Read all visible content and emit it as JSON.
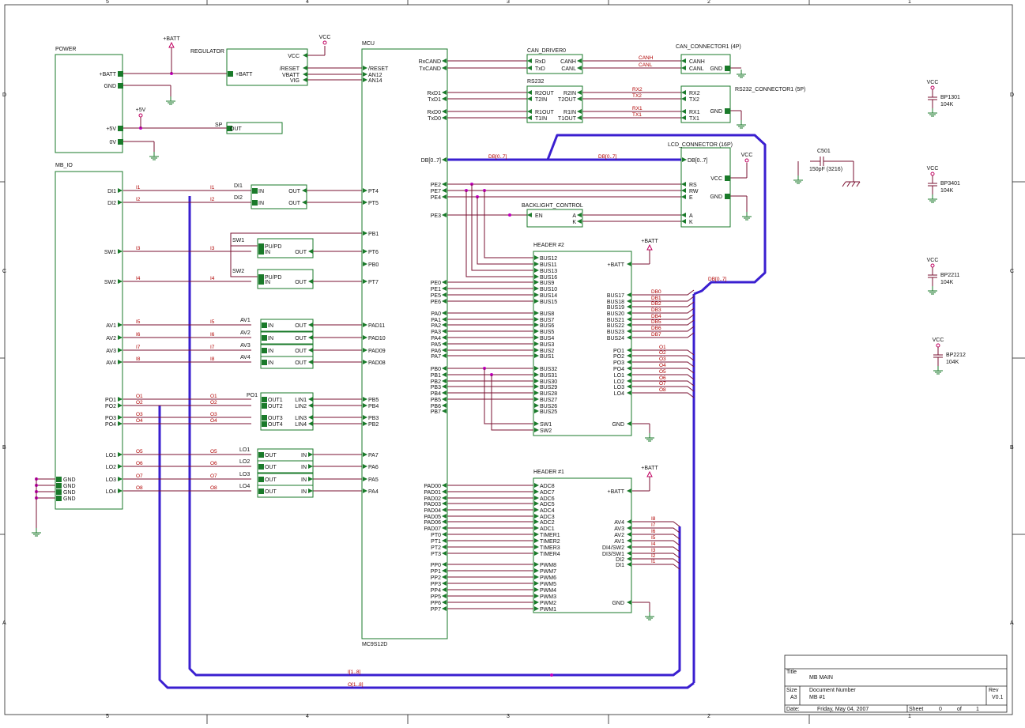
{
  "sheet": {
    "zone_labels_top": [
      "5",
      "4",
      "3",
      "2",
      "1"
    ],
    "zone_labels_side": [
      "D",
      "C",
      "B",
      "A"
    ]
  },
  "title_block": {
    "title_label": "Title",
    "title": "MB MAIN",
    "size_label": "Size",
    "size": "A3",
    "docnum_label": "Document Number",
    "docnum": "MB #1",
    "rev_label": "Rev",
    "rev": "V0.1",
    "date_label": "Date:",
    "date": "Friday, May 04, 2007",
    "sheet_label": "Sheet",
    "sheet_num": "0",
    "of_label": "of",
    "sheet_total": "1"
  },
  "power": {
    "name": "POWER",
    "pins": [
      "+BATT",
      "GND",
      "+5V",
      "0V"
    ]
  },
  "regulator": {
    "name": "REGULATOR",
    "in_pin": "+BATT",
    "out_pins": [
      "VCC",
      "/RESET",
      "VBATT",
      "VIG"
    ]
  },
  "sp": {
    "name": "SP",
    "pin": "OUT"
  },
  "supplies": {
    "batt": "+BATT",
    "vcc": "VCC",
    "p5v": "+5V"
  },
  "mbio": {
    "name": "MB_IO",
    "pins": [
      "DI1",
      "DI2",
      "SW1",
      "SW2",
      "AV1",
      "AV2",
      "AV3",
      "AV4",
      "PO1",
      "PO2",
      "PO3",
      "PO4",
      "LO1",
      "LO2",
      "LO3",
      "LO4"
    ],
    "gnd_pins": [
      "GND",
      "GND",
      "GND",
      "GND"
    ]
  },
  "nets_left": [
    "I1",
    "I2",
    "I3",
    "I4",
    "I5",
    "I6",
    "I7",
    "I8",
    "O1",
    "O2",
    "O3",
    "O4",
    "O5",
    "O6",
    "O7",
    "O8"
  ],
  "di_blocks": [
    {
      "name": "DI1",
      "in": "IN",
      "out": "OUT"
    },
    {
      "name": "DI2",
      "in": "IN",
      "out": "OUT"
    }
  ],
  "sw_blocks": [
    {
      "name": "SW1",
      "p1": "PU/PD",
      "p2": "IN",
      "out": "OUT"
    },
    {
      "name": "SW2",
      "p1": "PU/PD",
      "p2": "IN",
      "out": "OUT"
    }
  ],
  "av_blocks": [
    {
      "name": "AV1"
    },
    {
      "name": "AV2"
    },
    {
      "name": "AV3"
    },
    {
      "name": "AV4"
    }
  ],
  "po_block": {
    "name": "PO1",
    "pins_l": [
      "OUT1",
      "OUT2",
      "OUT3",
      "OUT4"
    ],
    "pins_r": [
      "LIN1",
      "LIN2",
      "LIN3",
      "LIN4"
    ]
  },
  "lo_blocks": [
    {
      "name": "LO1"
    },
    {
      "name": "LO2"
    },
    {
      "name": "LO3"
    },
    {
      "name": "LO4"
    }
  ],
  "mcu": {
    "name": "MCU",
    "part": "MC9S12D",
    "left_pins": [
      "/RESET",
      "AN12",
      "AN14",
      "PT4",
      "PT5",
      "PB1",
      "PT6",
      "PB0",
      "PT7",
      "PAD11",
      "PAD10",
      "PAD09",
      "PAD08",
      "PB5",
      "PB4",
      "PB3",
      "PB2",
      "PA7",
      "PA6",
      "PA5",
      "PA4"
    ],
    "right_pins": [
      "RxCAND",
      "TxCAND",
      "RxD1",
      "TxD1",
      "RxD0",
      "TxD0",
      "DB[0..7]",
      "PE2",
      "PE7",
      "PE4",
      "PE3",
      "PE0",
      "PE1",
      "PE5",
      "PE6",
      "PA0",
      "PA1",
      "PA2",
      "PA3",
      "PA4",
      "PA5",
      "PA6",
      "PA7",
      "PB0",
      "PB1",
      "PB2",
      "PB3",
      "PB4",
      "PB5",
      "PB6",
      "PB7",
      "PAD00",
      "PAD01",
      "PAD02",
      "PAD03",
      "PAD04",
      "PAD05",
      "PAD06",
      "PAD07",
      "PT0",
      "PT1",
      "PT2",
      "PT3",
      "PP0",
      "PP1",
      "PP2",
      "PP3",
      "PP4",
      "PP5",
      "PP6",
      "PP7"
    ]
  },
  "can_driver": {
    "name": "CAN_DRIVER0",
    "pins_l": [
      "RxD",
      "TxD"
    ],
    "pins_r": [
      "CANH",
      "CANL"
    ]
  },
  "can_conn": {
    "name": "CAN_CONNECTOR1 (4P)",
    "pins": [
      "CANH",
      "CANL",
      "GND"
    ],
    "nets": [
      "CANH",
      "CANL"
    ]
  },
  "rs232": {
    "name": "RS232",
    "pins_l": [
      "R2OUT",
      "T2IN",
      "R1OUT",
      "T1IN"
    ],
    "pins_r": [
      "R2IN",
      "T2OUT",
      "R1IN",
      "T1OUT"
    ],
    "nets": [
      "RX2",
      "TX2",
      "RX1",
      "TX1"
    ]
  },
  "rs232_conn": {
    "name": "RS232_CONNECTOR1 (5P)",
    "pins": [
      "RX2",
      "TX2",
      "GND",
      "RX1",
      "TX1"
    ]
  },
  "lcd": {
    "name": "LCD_CONNECTOR (16P)",
    "pins": [
      "DB[0..7]",
      "VCC",
      "RS",
      "RW",
      "E",
      "GND",
      "A",
      "K"
    ],
    "bus": "DB[0..7]"
  },
  "backlight": {
    "name": "BACKLIGHT_CONTROL",
    "in": "EN",
    "out": [
      "A",
      "K"
    ]
  },
  "header2": {
    "name": "HEADER #2",
    "left_pins": [
      "BUS12",
      "BUS11",
      "BUS13",
      "BUS16",
      "BUS9",
      "BUS10",
      "BUS14",
      "BUS15",
      "BUS8",
      "BUS7",
      "BUS6",
      "BUS5",
      "BUS4",
      "BUS3",
      "BUS2",
      "BUS1",
      "BUS32",
      "BUS31",
      "BUS30",
      "BUS29",
      "BUS28",
      "BUS27",
      "BUS26",
      "BUS25",
      "SW1",
      "SW2"
    ],
    "right_pins": [
      "+BATT",
      "BUS17",
      "BUS18",
      "BUS19",
      "BUS20",
      "BUS21",
      "BUS22",
      "BUS23",
      "BUS24",
      "PO1",
      "PO2",
      "PO3",
      "PO4",
      "LO1",
      "LO2",
      "LO3",
      "LO4",
      "GND"
    ],
    "db_nets": [
      "DB0",
      "DB1",
      "DB2",
      "DB3",
      "DB4",
      "DB5",
      "DB6",
      "DB7"
    ],
    "o_nets": [
      "O1",
      "O2",
      "O3",
      "O4",
      "O5",
      "O6",
      "O7",
      "O8"
    ]
  },
  "header1": {
    "name": "HEADER #1",
    "left_pins": [
      "ADC8",
      "ADC7",
      "ADC6",
      "ADC5",
      "ADC4",
      "ADC3",
      "ADC2",
      "ADC1",
      "TIMER1",
      "TIMER2",
      "TIMER3",
      "TIMER4",
      "PWM8",
      "PWM7",
      "PWM6",
      "PWM5",
      "PWM4",
      "PWM3",
      "PWM2",
      "PWM1"
    ],
    "right_pins": [
      "+BATT",
      "AV4",
      "AV3",
      "AV2",
      "AV1",
      "DI4/SW2",
      "DI3/SW1",
      "DI2",
      "DI1",
      "GND"
    ],
    "i_nets": [
      "I8",
      "I7",
      "I6",
      "I5",
      "I4",
      "I3",
      "I2",
      "I1"
    ]
  },
  "caps": [
    {
      "name": "C501",
      "value": "150pF (3216)"
    },
    {
      "name": "BP1301",
      "value": "104K"
    },
    {
      "name": "BP3401",
      "value": "104K"
    },
    {
      "name": "BP2211",
      "value": "104K"
    },
    {
      "name": "BP2212",
      "value": "104K"
    }
  ],
  "bus_labels": {
    "db": "DB[0..7]",
    "i": "I[1..8]",
    "o": "O[1..8]"
  }
}
